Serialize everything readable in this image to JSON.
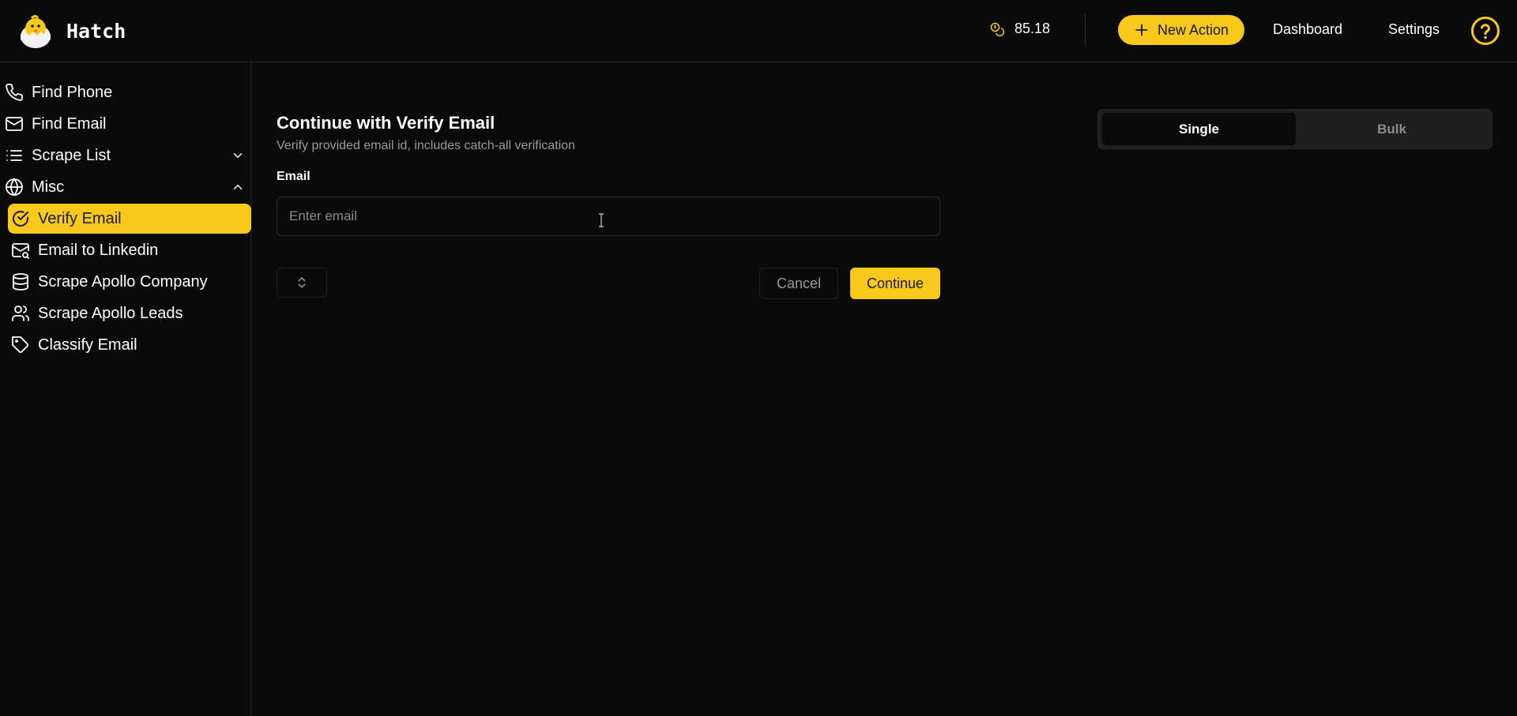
{
  "app": {
    "name": "Hatch"
  },
  "header": {
    "credits": "85.18",
    "new_action_label": "New Action",
    "nav": {
      "dashboard": "Dashboard",
      "settings": "Settings"
    }
  },
  "sidebar": {
    "items": [
      {
        "label": "Find Phone",
        "icon": "phone-icon"
      },
      {
        "label": "Find Email",
        "icon": "mail-icon"
      },
      {
        "label": "Scrape List",
        "icon": "list-icon",
        "expanded": false
      },
      {
        "label": "Misc",
        "icon": "globe-icon",
        "expanded": true
      }
    ],
    "sub_items": [
      {
        "label": "Verify Email",
        "icon": "check-circle-icon",
        "active": true
      },
      {
        "label": "Email to Linkedin",
        "icon": "mail-search-icon"
      },
      {
        "label": "Scrape Apollo Company",
        "icon": "database-icon"
      },
      {
        "label": "Scrape Apollo Leads",
        "icon": "users-icon"
      },
      {
        "label": "Classify Email",
        "icon": "tag-icon"
      }
    ]
  },
  "form": {
    "title": "Continue with Verify Email",
    "subtitle": "Verify provided email id, includes catch-all verification",
    "email_label": "Email",
    "email_placeholder": "Enter email",
    "email_value": "",
    "cancel_label": "Cancel",
    "continue_label": "Continue"
  },
  "mode_toggle": {
    "single_label": "Single",
    "bulk_label": "Bulk",
    "selected": "Single"
  },
  "colors": {
    "accent": "#f8c81b",
    "background": "#0a0a0a",
    "muted_text": "#9a9a9a"
  }
}
